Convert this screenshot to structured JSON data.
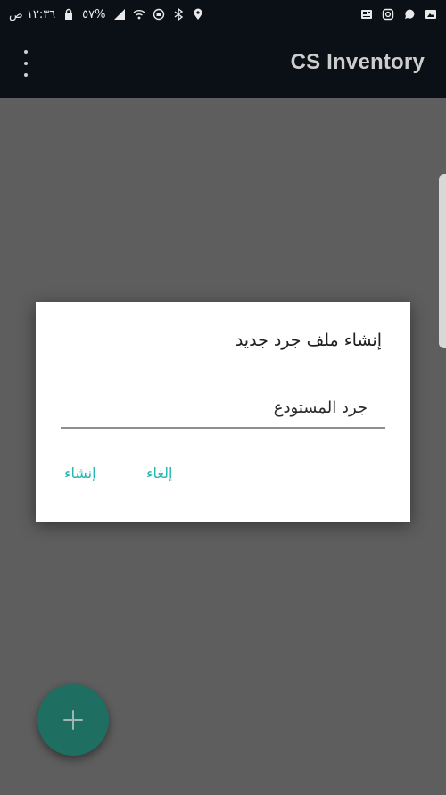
{
  "status_bar": {
    "time": "١٢:٣٦ ص",
    "battery": "٥٧%",
    "icons_left": [
      "lock-icon",
      "signal-icon",
      "wifi-icon",
      "data-saver-icon",
      "bluetooth-icon",
      "location-icon"
    ],
    "icons_right": [
      "news-icon",
      "instagram-icon",
      "whatsapp-icon",
      "gallery-icon"
    ]
  },
  "app_bar": {
    "title": "CS Inventory",
    "menu_icon": "kebab-menu-icon"
  },
  "dialog": {
    "title": "إنشاء ملف جرد جديد",
    "input_value": "جرد المستودع",
    "cancel_label": "إلغاء",
    "create_label": "إنشاء"
  },
  "fab": {
    "icon": "plus-icon"
  },
  "colors": {
    "app_bar": "#0b1016",
    "scrim": "#5e5e5e",
    "accent": "#22b8b0",
    "fab": "#1e6e62"
  }
}
